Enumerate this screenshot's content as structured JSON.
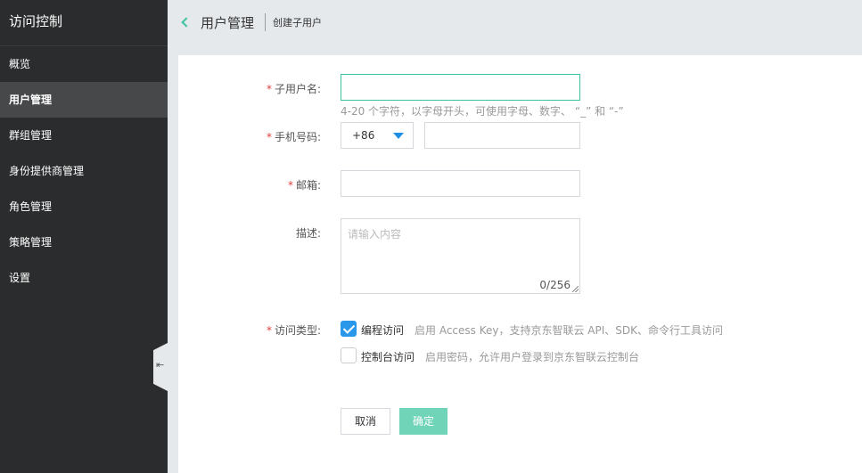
{
  "sidebar": {
    "title": "访问控制",
    "items": [
      {
        "label": "概览",
        "active": false
      },
      {
        "label": "用户管理",
        "active": true
      },
      {
        "label": "群组管理",
        "active": false
      },
      {
        "label": "身份提供商管理",
        "active": false
      },
      {
        "label": "角色管理",
        "active": false
      },
      {
        "label": "策略管理",
        "active": false
      },
      {
        "label": "设置",
        "active": false
      }
    ],
    "collapse_glyph": "⇤"
  },
  "header": {
    "title": "用户管理",
    "subtitle": "创建子用户"
  },
  "form": {
    "required_mark": "*",
    "username": {
      "label": "子用户名:",
      "value": "",
      "hint": "4-20 个字符，以字母开头，可使用字母、数字、 “_” 和 “-”"
    },
    "phone": {
      "label": "手机号码:",
      "country_code": "+86",
      "value": ""
    },
    "email": {
      "label": "邮箱:",
      "value": ""
    },
    "description": {
      "label": "描述:",
      "placeholder": "请输入内容",
      "counter": "0/256"
    },
    "access_type": {
      "label": "访问类型:",
      "options": [
        {
          "label": "编程访问",
          "checked": true,
          "desc": "启用 Access Key，支持京东智联云 API、SDK、命令行工具访问"
        },
        {
          "label": "控制台访问",
          "checked": false,
          "desc": "启用密码，允许用户登录到京东智联云控制台"
        }
      ]
    },
    "cancel_label": "取消",
    "ok_label": "确定"
  },
  "colors": {
    "accent": "#3ac3a0",
    "checkbox": "#2a98ea",
    "required": "#e0403a",
    "sidebar_bg": "#2b2c2d"
  }
}
